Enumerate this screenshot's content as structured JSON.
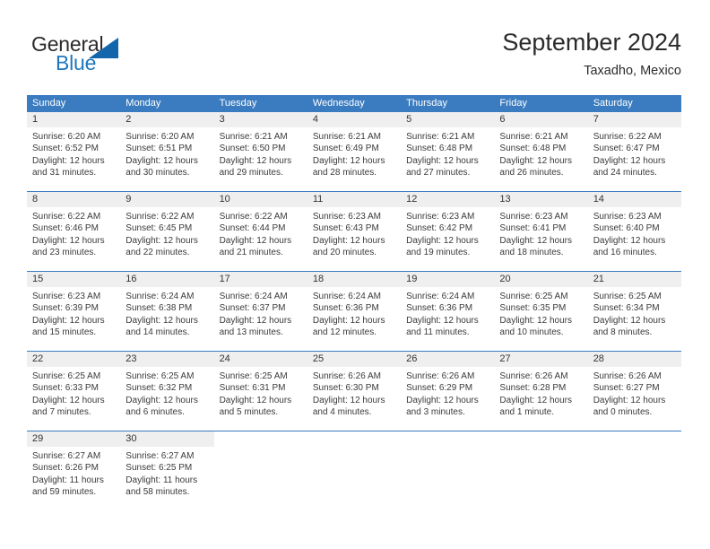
{
  "brand": {
    "name_part1": "General",
    "name_part2": "Blue",
    "accent_color": "#1366ab",
    "text_color": "#2b2b2b"
  },
  "header": {
    "title": "September 2024",
    "subtitle": "Taxadho, Mexico"
  },
  "calendar": {
    "header_bg": "#3b7cc0",
    "daynum_bg": "#efefef",
    "weekdays": [
      "Sunday",
      "Monday",
      "Tuesday",
      "Wednesday",
      "Thursday",
      "Friday",
      "Saturday"
    ],
    "weeks": [
      [
        {
          "day": "1",
          "lines": [
            "Sunrise: 6:20 AM",
            "Sunset: 6:52 PM",
            "Daylight: 12 hours",
            "and 31 minutes."
          ]
        },
        {
          "day": "2",
          "lines": [
            "Sunrise: 6:20 AM",
            "Sunset: 6:51 PM",
            "Daylight: 12 hours",
            "and 30 minutes."
          ]
        },
        {
          "day": "3",
          "lines": [
            "Sunrise: 6:21 AM",
            "Sunset: 6:50 PM",
            "Daylight: 12 hours",
            "and 29 minutes."
          ]
        },
        {
          "day": "4",
          "lines": [
            "Sunrise: 6:21 AM",
            "Sunset: 6:49 PM",
            "Daylight: 12 hours",
            "and 28 minutes."
          ]
        },
        {
          "day": "5",
          "lines": [
            "Sunrise: 6:21 AM",
            "Sunset: 6:48 PM",
            "Daylight: 12 hours",
            "and 27 minutes."
          ]
        },
        {
          "day": "6",
          "lines": [
            "Sunrise: 6:21 AM",
            "Sunset: 6:48 PM",
            "Daylight: 12 hours",
            "and 26 minutes."
          ]
        },
        {
          "day": "7",
          "lines": [
            "Sunrise: 6:22 AM",
            "Sunset: 6:47 PM",
            "Daylight: 12 hours",
            "and 24 minutes."
          ]
        }
      ],
      [
        {
          "day": "8",
          "lines": [
            "Sunrise: 6:22 AM",
            "Sunset: 6:46 PM",
            "Daylight: 12 hours",
            "and 23 minutes."
          ]
        },
        {
          "day": "9",
          "lines": [
            "Sunrise: 6:22 AM",
            "Sunset: 6:45 PM",
            "Daylight: 12 hours",
            "and 22 minutes."
          ]
        },
        {
          "day": "10",
          "lines": [
            "Sunrise: 6:22 AM",
            "Sunset: 6:44 PM",
            "Daylight: 12 hours",
            "and 21 minutes."
          ]
        },
        {
          "day": "11",
          "lines": [
            "Sunrise: 6:23 AM",
            "Sunset: 6:43 PM",
            "Daylight: 12 hours",
            "and 20 minutes."
          ]
        },
        {
          "day": "12",
          "lines": [
            "Sunrise: 6:23 AM",
            "Sunset: 6:42 PM",
            "Daylight: 12 hours",
            "and 19 minutes."
          ]
        },
        {
          "day": "13",
          "lines": [
            "Sunrise: 6:23 AM",
            "Sunset: 6:41 PM",
            "Daylight: 12 hours",
            "and 18 minutes."
          ]
        },
        {
          "day": "14",
          "lines": [
            "Sunrise: 6:23 AM",
            "Sunset: 6:40 PM",
            "Daylight: 12 hours",
            "and 16 minutes."
          ]
        }
      ],
      [
        {
          "day": "15",
          "lines": [
            "Sunrise: 6:23 AM",
            "Sunset: 6:39 PM",
            "Daylight: 12 hours",
            "and 15 minutes."
          ]
        },
        {
          "day": "16",
          "lines": [
            "Sunrise: 6:24 AM",
            "Sunset: 6:38 PM",
            "Daylight: 12 hours",
            "and 14 minutes."
          ]
        },
        {
          "day": "17",
          "lines": [
            "Sunrise: 6:24 AM",
            "Sunset: 6:37 PM",
            "Daylight: 12 hours",
            "and 13 minutes."
          ]
        },
        {
          "day": "18",
          "lines": [
            "Sunrise: 6:24 AM",
            "Sunset: 6:36 PM",
            "Daylight: 12 hours",
            "and 12 minutes."
          ]
        },
        {
          "day": "19",
          "lines": [
            "Sunrise: 6:24 AM",
            "Sunset: 6:36 PM",
            "Daylight: 12 hours",
            "and 11 minutes."
          ]
        },
        {
          "day": "20",
          "lines": [
            "Sunrise: 6:25 AM",
            "Sunset: 6:35 PM",
            "Daylight: 12 hours",
            "and 10 minutes."
          ]
        },
        {
          "day": "21",
          "lines": [
            "Sunrise: 6:25 AM",
            "Sunset: 6:34 PM",
            "Daylight: 12 hours",
            "and 8 minutes."
          ]
        }
      ],
      [
        {
          "day": "22",
          "lines": [
            "Sunrise: 6:25 AM",
            "Sunset: 6:33 PM",
            "Daylight: 12 hours",
            "and 7 minutes."
          ]
        },
        {
          "day": "23",
          "lines": [
            "Sunrise: 6:25 AM",
            "Sunset: 6:32 PM",
            "Daylight: 12 hours",
            "and 6 minutes."
          ]
        },
        {
          "day": "24",
          "lines": [
            "Sunrise: 6:25 AM",
            "Sunset: 6:31 PM",
            "Daylight: 12 hours",
            "and 5 minutes."
          ]
        },
        {
          "day": "25",
          "lines": [
            "Sunrise: 6:26 AM",
            "Sunset: 6:30 PM",
            "Daylight: 12 hours",
            "and 4 minutes."
          ]
        },
        {
          "day": "26",
          "lines": [
            "Sunrise: 6:26 AM",
            "Sunset: 6:29 PM",
            "Daylight: 12 hours",
            "and 3 minutes."
          ]
        },
        {
          "day": "27",
          "lines": [
            "Sunrise: 6:26 AM",
            "Sunset: 6:28 PM",
            "Daylight: 12 hours",
            "and 1 minute."
          ]
        },
        {
          "day": "28",
          "lines": [
            "Sunrise: 6:26 AM",
            "Sunset: 6:27 PM",
            "Daylight: 12 hours",
            "and 0 minutes."
          ]
        }
      ],
      [
        {
          "day": "29",
          "lines": [
            "Sunrise: 6:27 AM",
            "Sunset: 6:26 PM",
            "Daylight: 11 hours",
            "and 59 minutes."
          ]
        },
        {
          "day": "30",
          "lines": [
            "Sunrise: 6:27 AM",
            "Sunset: 6:25 PM",
            "Daylight: 11 hours",
            "and 58 minutes."
          ]
        },
        {
          "day": "",
          "lines": []
        },
        {
          "day": "",
          "lines": []
        },
        {
          "day": "",
          "lines": []
        },
        {
          "day": "",
          "lines": []
        },
        {
          "day": "",
          "lines": []
        }
      ]
    ]
  }
}
